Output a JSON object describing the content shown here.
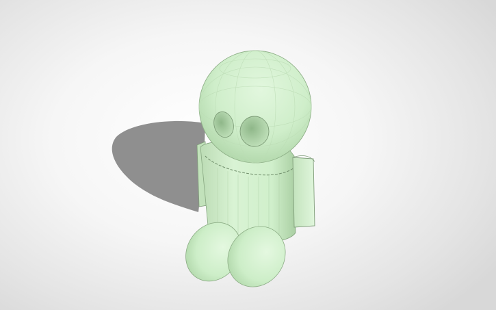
{
  "scene": {
    "subject": "3d-robot-model",
    "colors": {
      "model_fill": "#d4f0cf",
      "model_shade": "#b7d9b1",
      "model_dark": "#9cc296",
      "edge": "#6f8d6a",
      "shadow": "#8f8f8f",
      "background_center": "#ffffff",
      "background_edge": "#d8d8d8"
    }
  }
}
